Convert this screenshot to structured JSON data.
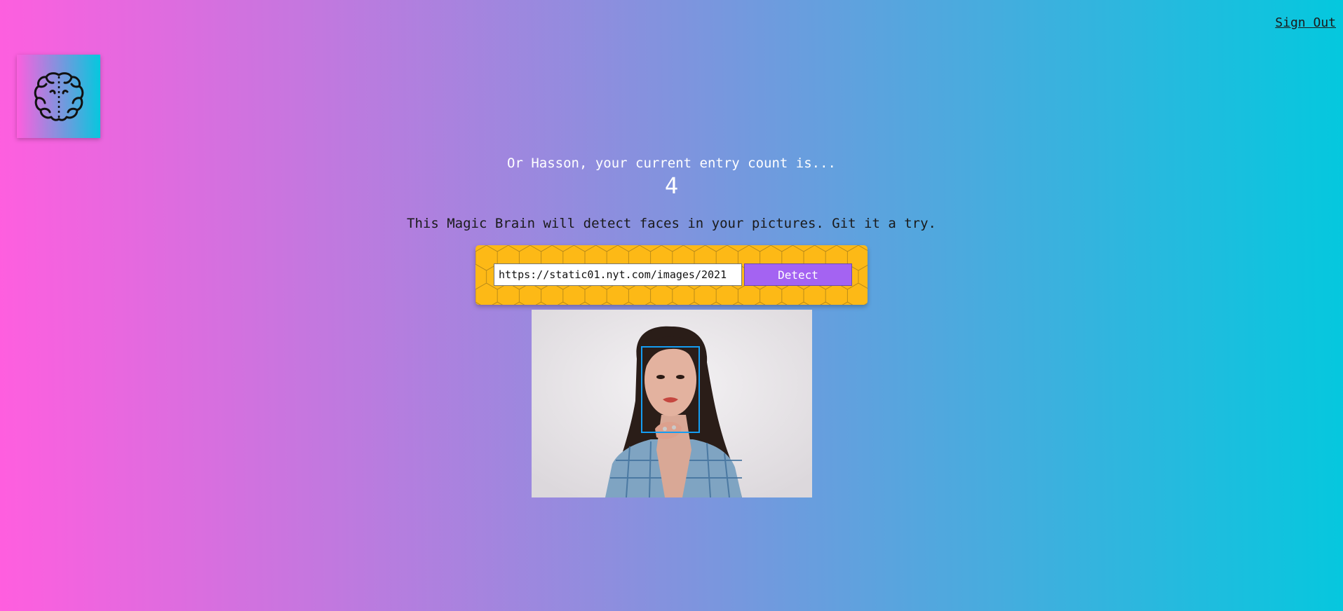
{
  "nav": {
    "sign_out_label": "Sign Out"
  },
  "logo": {
    "icon": "brain-icon"
  },
  "rank": {
    "message": "Or Hasson, your current entry count is...",
    "count": "4"
  },
  "intro": {
    "text": "This Magic Brain will detect faces in your pictures. Git it a try."
  },
  "form": {
    "url_value": "https://static01.nyt.com/images/2021",
    "detect_label": "Detect"
  },
  "result": {
    "image_icon": "portrait-photo",
    "faces_detected": 1
  },
  "colors": {
    "gradient_start": "#ff5edf",
    "gradient_end": "#04c8de",
    "form_background": "#fdb916",
    "detect_button": "#a463f2",
    "bounding_box": "#149df2"
  }
}
